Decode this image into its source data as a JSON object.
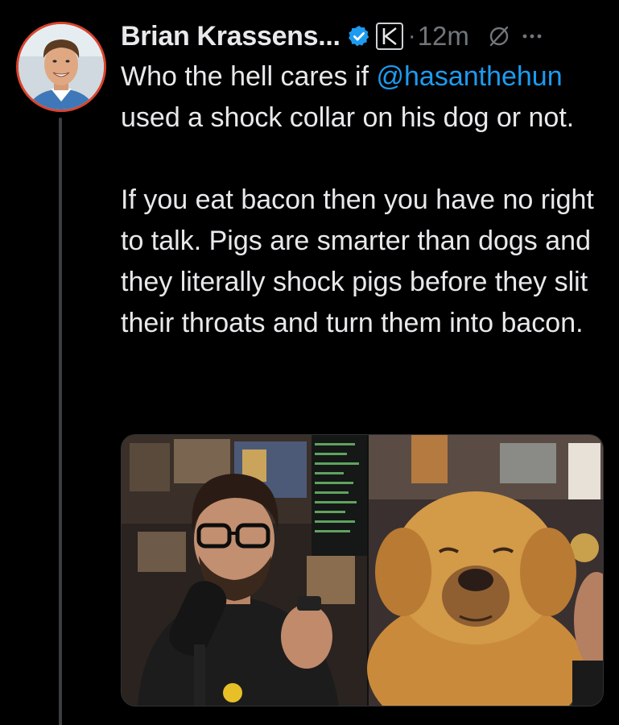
{
  "tweet": {
    "author_name": "Brian Krassens...",
    "time": "12m",
    "dot": "·",
    "mention": "@hasanthehun",
    "line1": "Who the hell cares if ",
    "line2": " used a shock collar on his dog or not.",
    "paragraph2": "If you eat bacon then you have no right to talk. Pigs are smarter than dogs and they literally shock pigs before they slit their throats and turn them into bacon.",
    "verified_icon": "verified-badge-icon",
    "affiliate_icon": "kalshi-k-icon",
    "grok_icon": "grok-icon",
    "more_icon": "more-dots-icon"
  },
  "colors": {
    "background": "#000000",
    "text": "#e7e9ea",
    "secondary": "#71767b",
    "link": "#1d9bf0",
    "verified": "#1d9bf0",
    "avatar_ring": "#d9442f"
  }
}
